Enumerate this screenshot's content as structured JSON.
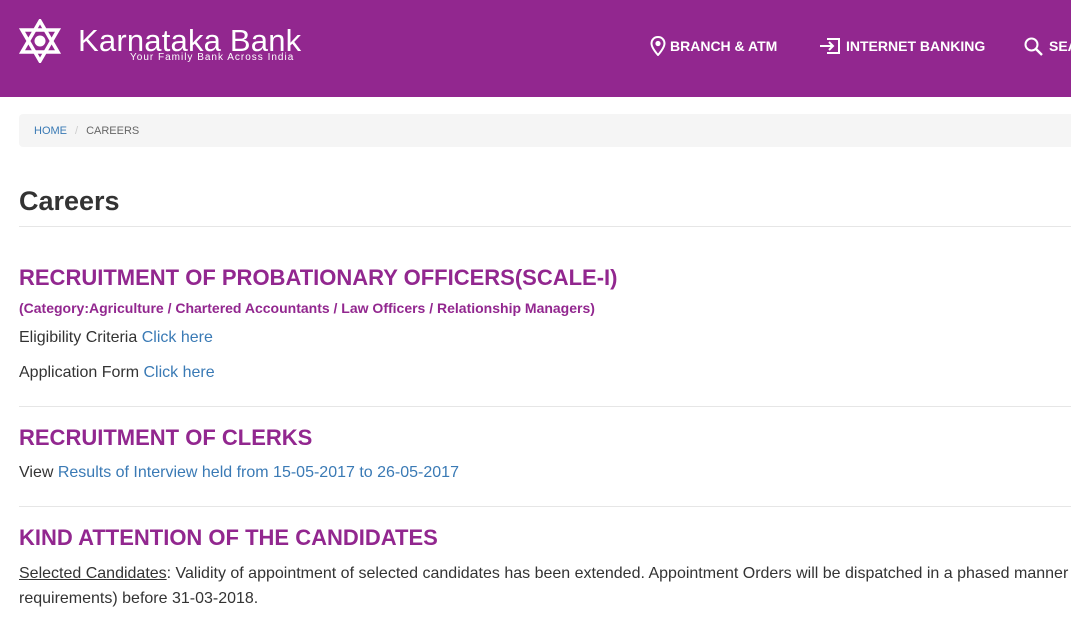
{
  "header": {
    "brand_name": "Karnataka Bank",
    "tagline": "Your Family Bank Across India",
    "logo_icon": "star-of-david-logo-icon",
    "nav": [
      {
        "label": "BRANCH & ATM",
        "icon": "map-pin-icon"
      },
      {
        "label": "INTERNET BANKING",
        "icon": "login-icon"
      },
      {
        "label": "SEA",
        "icon": "search-icon"
      }
    ],
    "bg_color": "#92278f"
  },
  "breadcrumb": {
    "home": "HOME",
    "separator": "/",
    "current": "CAREERS"
  },
  "page": {
    "title": "Careers"
  },
  "sections": {
    "po": {
      "title": "RECRUITMENT OF PROBATIONARY  OFFICERS(SCALE-I)",
      "subtitle": "(Category:Agriculture / Chartered Accountants / Law Officers / Relationship Managers)",
      "eligibility_label": "Eligibility Criteria ",
      "eligibility_link": "Click here",
      "application_label": "Application Form ",
      "application_link": "Click here"
    },
    "clerks": {
      "title": "RECRUITMENT OF CLERKS",
      "view_label": "View ",
      "results_link": "Results of Interview held from 15-05-2017 to 26-05-2017"
    },
    "attention": {
      "title": "KIND ATTENTION OF THE CANDIDATES",
      "selected_label": "Selected Candidates",
      "text_line1": ": Validity of appointment of selected candidates has been extended. Appointment Orders will be dispatched in a phased manner",
      "text_line2": "requirements) before 31-03-2018."
    }
  },
  "colors": {
    "accent": "#92278f",
    "link": "#3a7ab5",
    "text": "#333333"
  }
}
